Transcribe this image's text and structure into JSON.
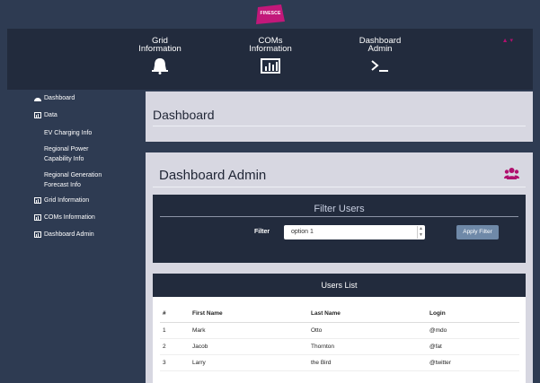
{
  "brand": {
    "logo_text": "FINESCE",
    "logo_color": "#c2187a"
  },
  "header": {
    "nav": [
      {
        "line1": "Grid",
        "line2": "Information",
        "icon": "bell-icon"
      },
      {
        "line1": "COMs",
        "line2": "Information",
        "icon": "bar-chart-icon"
      },
      {
        "line1": "Dashboard",
        "line2": "Admin",
        "icon": "terminal-icon"
      }
    ],
    "corner_badge": "▲ ▾"
  },
  "sidebar": {
    "dashboard": "Dashboard",
    "data": "Data",
    "sub": [
      "EV Charging Info",
      "Regional Power Capability Info",
      "Regional Generation Forecast Info"
    ],
    "grid_info": "Grid Information",
    "coms_info": "COMs Information",
    "dashboard_admin": "Dashboard Admin"
  },
  "main": {
    "page_title": "Dashboard",
    "section_title": "Dashboard Admin",
    "filter": {
      "title": "Filter Users",
      "label": "Filter",
      "value": "option 1",
      "apply_label": "Apply Filter"
    },
    "users": {
      "title": "Users List",
      "columns": [
        "#",
        "First Name",
        "Last Name",
        "Login"
      ],
      "rows": [
        [
          "1",
          "Mark",
          "Otto",
          "@mdo"
        ],
        [
          "2",
          "Jacob",
          "Thornton",
          "@fat"
        ],
        [
          "3",
          "Larry",
          "the Bird",
          "@twitter"
        ]
      ]
    }
  },
  "colors": {
    "accent": "#b0106e",
    "navbar": "#222b3d",
    "panel": "#d7d7e1",
    "button": "#6f89a8"
  }
}
